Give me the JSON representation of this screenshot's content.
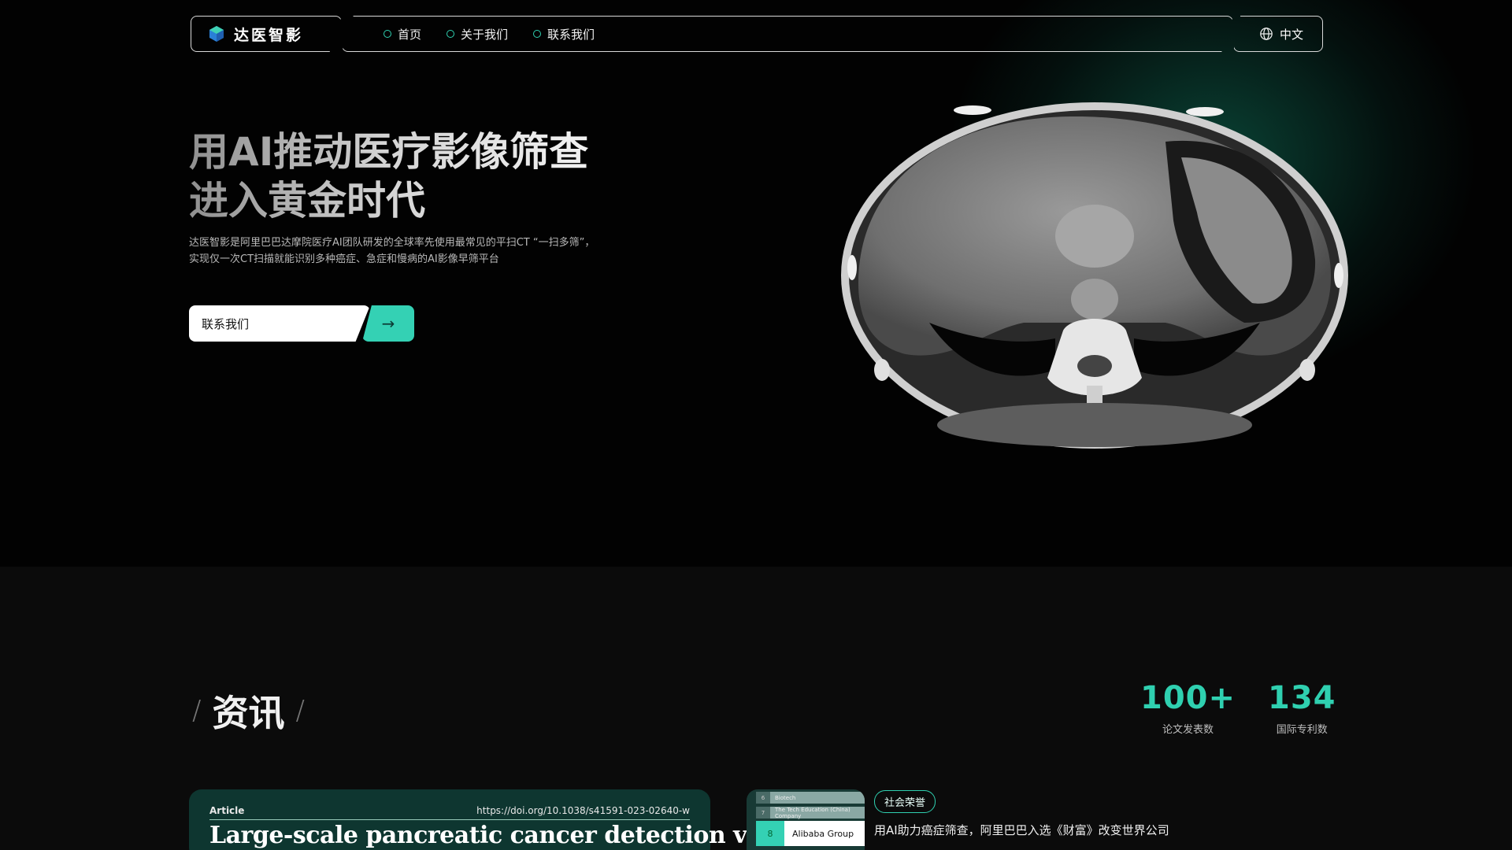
{
  "nav": {
    "logo_text": "达医智影",
    "menu": [
      {
        "label": "首页"
      },
      {
        "label": "关于我们"
      },
      {
        "label": "联系我们"
      }
    ],
    "language": "中文"
  },
  "hero": {
    "title_line1": "用AI推动医疗影像筛查",
    "title_line2": "进入黄金时代",
    "description": "达医智影是阿里巴巴达摩院医疗AI团队研发的全球率先使用最常见的平扫CT “一扫多筛”，实现仅一次CT扫描就能识别多种癌症、急症和慢病的AI影像早筛平台",
    "cta_label": "联系我们",
    "cta_arrow": "→"
  },
  "news": {
    "title": "资讯",
    "stats": [
      {
        "value": "100+",
        "label": "论文发表数"
      },
      {
        "value": "134",
        "label": "国际专利数"
      }
    ],
    "article": {
      "type_label": "Article",
      "doi": "https://doi.org/10.1038/s41591-023-02640-w",
      "headline": "Large-scale pancreatic cancer detection via"
    },
    "ranking": {
      "rows": [
        {
          "num": "6",
          "name": "Biotech"
        },
        {
          "num": "7",
          "name": "The Tech Education (China) Company"
        }
      ],
      "highlight": {
        "num": "8",
        "name": "Alibaba Group"
      }
    },
    "tag": "社会荣誉",
    "headline2": "用AI助力癌症筛查，阿里巴巴入选《财富》改变世界公司"
  },
  "colors": {
    "accent": "#34d1b4",
    "background": "#0b0b0b",
    "card": "#0e3630"
  }
}
